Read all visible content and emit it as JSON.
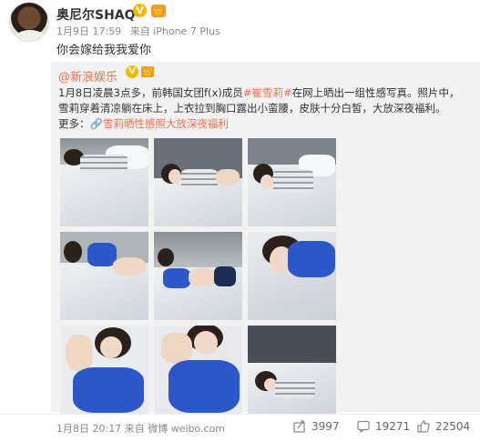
{
  "post": {
    "username": "奥尼尔SHAQ",
    "badge_letter": "V",
    "crown_text": "👑",
    "time": "1月9日 17:59",
    "source": "来自 iPhone 7 Plus",
    "text": "你会嫁给我我爱你"
  },
  "repost": {
    "username": "@新浪娱乐",
    "badge_letter": "V",
    "crown_text": "👑",
    "line1_a": "1月8日凌晨3点多，前韩国女团f(x)成员",
    "line1_tag": "#崔雪莉#",
    "line1_b": "在网上晒出一组性感写真。照片中，",
    "line2": "雪莉穿着清凉躺在床上，上衣拉到胸口露出小蛮腰，皮肤十分白皙，大放深夜福利。",
    "line3_prefix": "更多：",
    "line3_link": "🔗雪莉晒性感照大放深夜福利"
  },
  "footer": {
    "time": "1月8日 20:17",
    "source": "来自 微博 weibo.com",
    "reposts": "3997",
    "comments": "19271",
    "likes": "22504"
  }
}
